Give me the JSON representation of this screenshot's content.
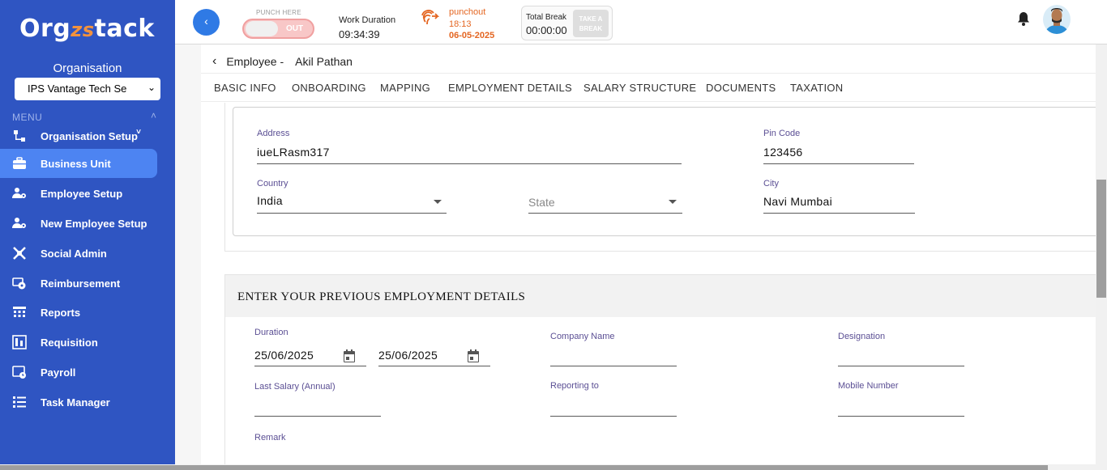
{
  "sidebar": {
    "logo_text": "Orgzstack",
    "org_label": "Organisation",
    "org_selected": "IPS Vantage Tech Se",
    "menu_label": "MENU",
    "items": [
      {
        "label": "Organisation Setup",
        "icon": "org-setup-icon"
      },
      {
        "label": "Business Unit",
        "icon": "briefcase-icon",
        "active": true
      },
      {
        "label": "Employee Setup",
        "icon": "employee-gear-icon"
      },
      {
        "label": "New Employee Setup",
        "icon": "employee-gear-icon"
      },
      {
        "label": "Social Admin",
        "icon": "social-admin-icon"
      },
      {
        "label": "Reimbursement",
        "icon": "reimbursement-icon"
      },
      {
        "label": "Reports",
        "icon": "reports-icon"
      },
      {
        "label": "Requisition",
        "icon": "requisition-icon"
      },
      {
        "label": "Payroll",
        "icon": "payroll-icon"
      },
      {
        "label": "Task Manager",
        "icon": "task-manager-icon"
      }
    ]
  },
  "header": {
    "back_glyph": "‹",
    "punch_here": "PUNCH HERE",
    "punch_state": "OUT",
    "work_duration_label": "Work Duration",
    "work_duration_value": "09:34:39",
    "punchout_label": "punchout",
    "punchout_time": "18:13",
    "punchout_date": "06-05-2025",
    "total_break_label": "Total Break",
    "total_break_value": "00:00:00",
    "take_break_label": "TAKE A BREAK"
  },
  "breadcrumb": {
    "section": "Employee -",
    "name": "Akil Pathan"
  },
  "tabs": [
    "BASIC INFO",
    "ONBOARDING",
    "MAPPING",
    "EMPLOYMENT DETAILS",
    "SALARY STRUCTURE",
    "DOCUMENTS",
    "TAXATION"
  ],
  "address_form": {
    "address_label": "Address",
    "address_value": "iueLRasm317",
    "pincode_label": "Pin Code",
    "pincode_value": "123456",
    "country_label": "Country",
    "country_value": "India",
    "state_placeholder": "State",
    "city_label": "City",
    "city_value": "Navi Mumbai"
  },
  "prev_employment": {
    "title": "ENTER YOUR PREVIOUS EMPLOYMENT DETAILS",
    "duration_label": "Duration",
    "from_date": "25/06/2025",
    "to_date": "25/06/2025",
    "company_label": "Company Name",
    "designation_label": "Designation",
    "last_salary_label": "Last Salary (Annual)",
    "reporting_label": "Reporting to",
    "mobile_label": "Mobile Number",
    "remark_label": "Remark"
  },
  "colors": {
    "sidebar_bg": "#2f55c2",
    "active_item": "#4d84f2",
    "punch_accent": "#e46622",
    "label_purple": "#5b4f94"
  }
}
